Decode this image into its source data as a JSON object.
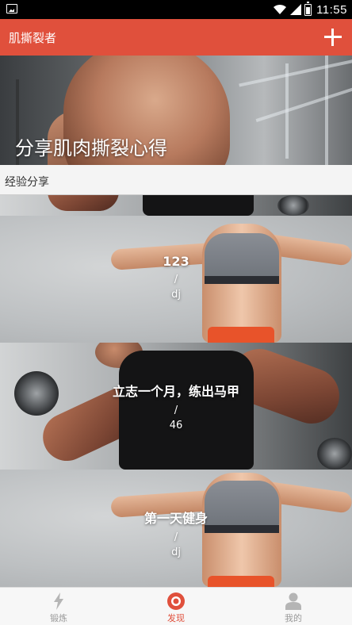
{
  "status_bar": {
    "time": "11:55"
  },
  "app_bar": {
    "title": "肌撕裂者",
    "add_icon": "plus-icon"
  },
  "hero": {
    "title": "分享肌肉撕裂心得"
  },
  "section": {
    "title": "经验分享"
  },
  "posts": [
    {
      "title": "123",
      "separator": "/",
      "author": "dj"
    },
    {
      "title": "立志一个月，练出马甲",
      "separator": "/",
      "author": "46"
    },
    {
      "title": "第一天健身",
      "separator": "/",
      "author": "dj"
    }
  ],
  "bottom_nav": {
    "active_color": "#e0503c",
    "items": [
      {
        "label": "锻炼",
        "icon": "lightning-icon",
        "active": false
      },
      {
        "label": "发现",
        "icon": "target-icon",
        "active": true
      },
      {
        "label": "我的",
        "icon": "person-icon",
        "active": false
      }
    ]
  }
}
